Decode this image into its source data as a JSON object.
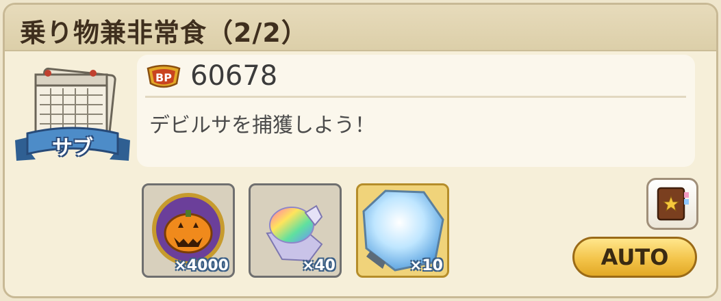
{
  "quest": {
    "title": "乗り物兼非常食（2/2）",
    "badge": "サブ",
    "bp_label": "BP",
    "bp_value": "60678",
    "description": "デビルサを捕獲しよう！"
  },
  "rewards": [
    {
      "icon": "pumpkin-medal-icon",
      "quantity": "×4000"
    },
    {
      "icon": "rainbow-crystal-icon",
      "quantity": "×40"
    },
    {
      "icon": "blue-crystal-icon",
      "quantity": "×10"
    }
  ],
  "buttons": {
    "book_icon": "star-book-icon",
    "auto_label": "AUTO"
  },
  "colors": {
    "panel": "#f6efd9",
    "title_bar": "#e2d6b4",
    "auto_button": "#f3c44a"
  }
}
